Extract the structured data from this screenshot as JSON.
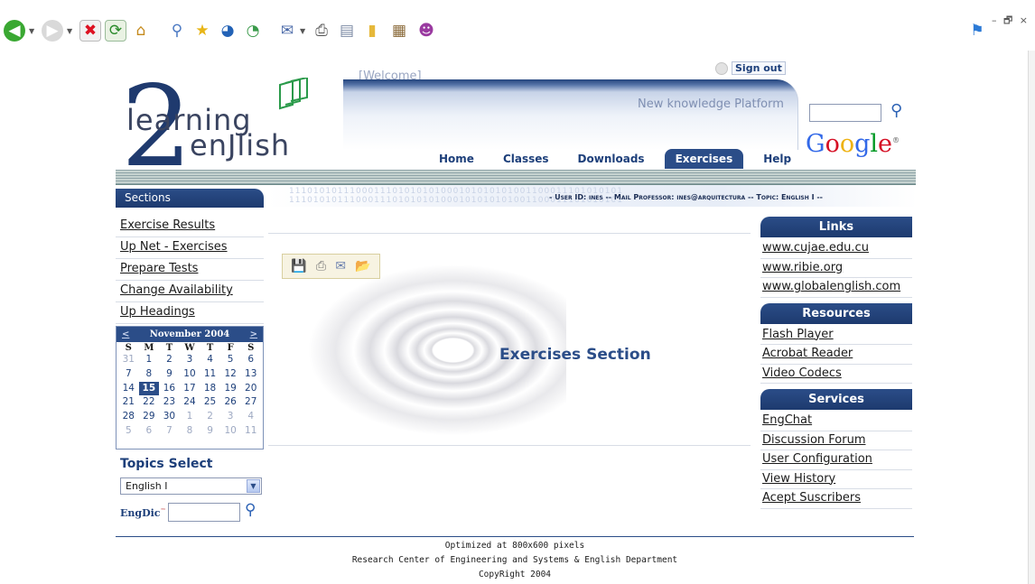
{
  "browser": {
    "toolbar_icons": [
      "back-icon",
      "forward-icon",
      "stop-icon",
      "refresh-icon",
      "home-icon",
      "search-icon",
      "favorites-icon",
      "media-icon",
      "history-icon",
      "mail-icon",
      "print-icon",
      "edit-icon",
      "discuss-icon",
      "research-icon",
      "messenger-icon"
    ],
    "window_controls": "– 🗗 ×"
  },
  "header": {
    "welcome": "[Welcome]",
    "sign_out": "Sign out",
    "platform": "New knowledge Platform",
    "logo_word1": "learning",
    "logo_word2": "enJlish",
    "logo_two": "2"
  },
  "nav": {
    "items": [
      {
        "label": "Home",
        "active": false
      },
      {
        "label": "Classes",
        "active": false
      },
      {
        "label": "Downloads",
        "active": false
      },
      {
        "label": "Exercises",
        "active": true
      },
      {
        "label": "Help",
        "active": false
      }
    ]
  },
  "google": {
    "letters": [
      "G",
      "o",
      "o",
      "g",
      "l",
      "e"
    ],
    "trademark": "®"
  },
  "sections": {
    "title": "Sections",
    "links": [
      "Exercise Results",
      "Up Net - Exercises",
      "Prepare Tests",
      "Change Availability",
      "Up Headings"
    ]
  },
  "info_bar": {
    "binary": "1110101011100011101010101000101010101001100011101010101",
    "text": "- User ID: ines -- Mail Professor: ines@arquitectura -- Topic: English I --"
  },
  "calendar": {
    "month": "November 2004",
    "prev": "<",
    "next": ">",
    "days_of_week": [
      "S",
      "M",
      "T",
      "W",
      "T",
      "F",
      "S"
    ],
    "weeks": [
      [
        "31",
        "1",
        "2",
        "3",
        "4",
        "5",
        "6"
      ],
      [
        "7",
        "8",
        "9",
        "10",
        "11",
        "12",
        "13"
      ],
      [
        "14",
        "15",
        "16",
        "17",
        "18",
        "19",
        "20"
      ],
      [
        "21",
        "22",
        "23",
        "24",
        "25",
        "26",
        "27"
      ],
      [
        "28",
        "29",
        "30",
        "1",
        "2",
        "3",
        "4"
      ],
      [
        "5",
        "6",
        "7",
        "8",
        "9",
        "10",
        "11"
      ]
    ],
    "today": "15"
  },
  "topics": {
    "title": "Topics Select",
    "selected": "English I"
  },
  "engdic": {
    "label": "EngDic",
    "mark": "™"
  },
  "main": {
    "title": "Exercises Section",
    "file_tools": [
      "save-icon",
      "print-icon",
      "email-icon",
      "folder-icon"
    ]
  },
  "right": {
    "links_title": "Links",
    "links": [
      "www.cujae.edu.cu",
      "www.ribie.org",
      "www.globalenglish.com"
    ],
    "resources_title": "Resources",
    "resources": [
      "Flash Player",
      "Acrobat Reader",
      "Video Codecs"
    ],
    "services_title": "Services",
    "services": [
      "EngChat",
      "Discussion Forum",
      "User Configuration",
      "View History",
      "Acept Suscribers"
    ]
  },
  "footer": {
    "line1": "Optimized at 800x600 pixels",
    "line2": "Research Center of Engineering and Systems & English Department",
    "line3": "CopyRight 2004"
  },
  "colors": {
    "navy": "#2b4d88",
    "dark_navy": "#1d3a6e",
    "band_green": "#8fa4a8"
  }
}
